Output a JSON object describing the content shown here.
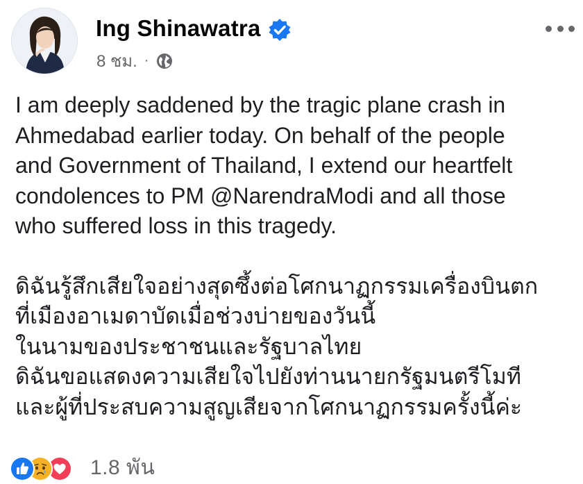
{
  "post": {
    "author": "Ing Shinawatra",
    "time": "8 ชม.",
    "separator": "·",
    "audience_icon": "globe-icon",
    "verified_icon": "verified-badge-icon",
    "more_icon": "more-options-icon",
    "english_lines": [
      "I am deeply saddened by the tragic plane crash in",
      "Ahmedabad earlier today. On behalf of the people",
      "and Government of Thailand, I extend our heartfelt",
      "condolences to PM @NarendraModi and all those",
      "who suffered loss in this tragedy."
    ],
    "thai_lines": [
      "ดิฉันรู้สึกเสียใจอย่างสุดซึ้งต่อโศกนาฏกรรมเครื่องบินตก",
      "ที่เมืองอาเมดาบัดเมื่อช่วงบ่ายของวันนี้",
      "ในนามของประชาชนและรัฐบาลไทย",
      "ดิฉันขอแสดงความเสียใจไปยังท่านนายกรัฐมนตรีโมที",
      "และผู้ที่ประสบความสูญเสียจากโศกนาฏกรรมครั้งนี้ค่ะ"
    ]
  },
  "reactions": {
    "icons": [
      "like-reaction-icon",
      "sad-reaction-icon",
      "love-reaction-icon"
    ],
    "count": "1.8 พัน"
  },
  "colors": {
    "verified": "#1877f2",
    "like": "#1877f2",
    "love": "#f33e58",
    "sad": "#f7b125",
    "meta_text": "#65676b"
  }
}
